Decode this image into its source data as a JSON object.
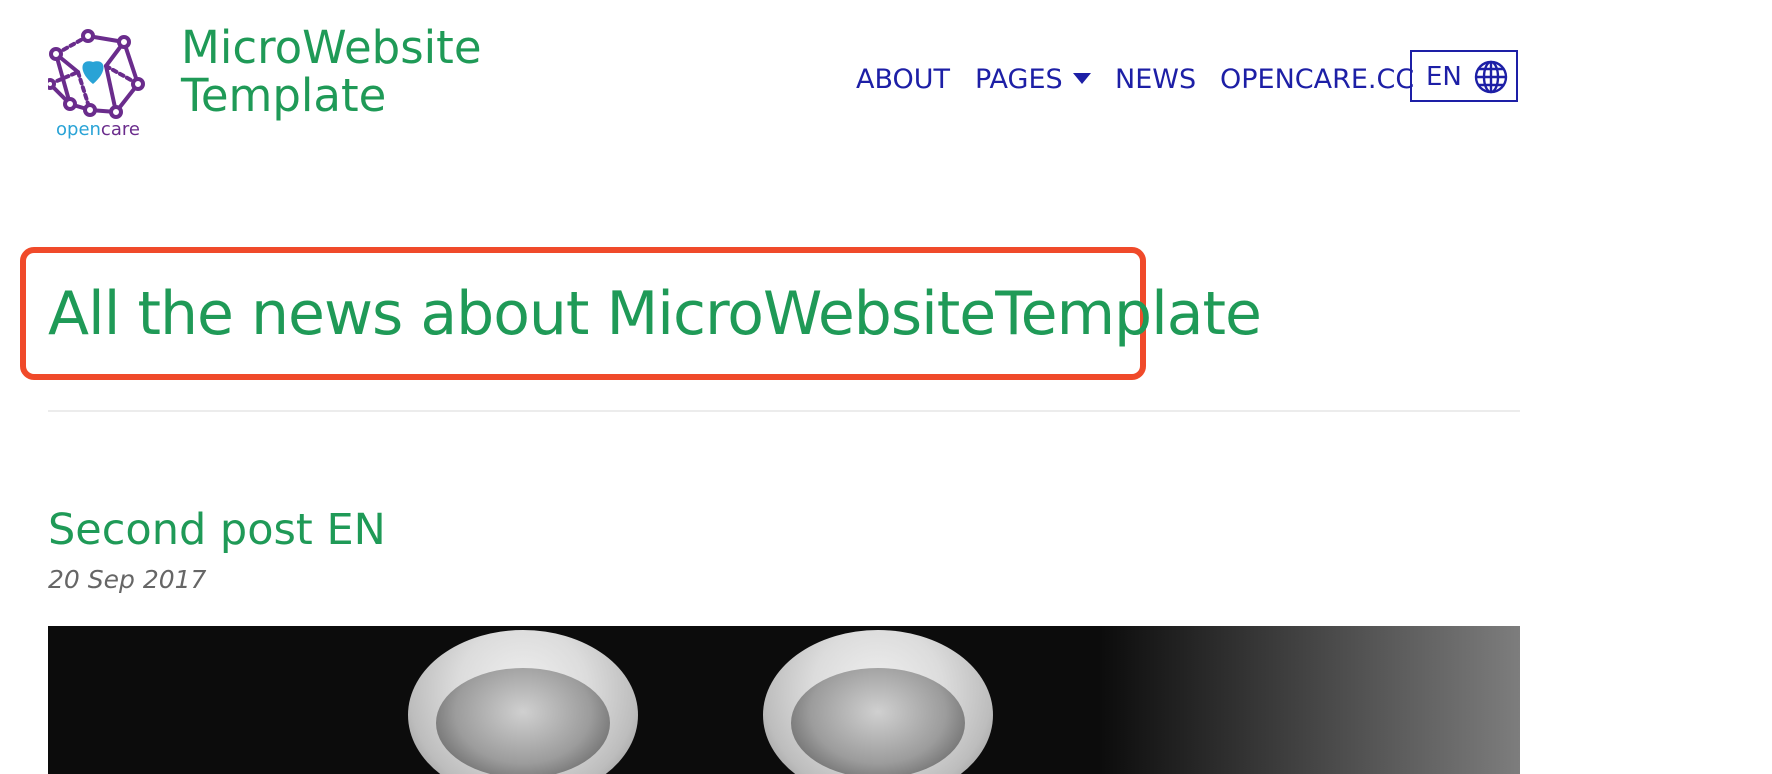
{
  "header": {
    "logo": {
      "word_open": "open",
      "word_care": "care",
      "colors": {
        "purple": "#6a2c8c",
        "blue": "#29a3d6"
      }
    },
    "site_title": "MicroWebsite Template",
    "nav": {
      "items": [
        {
          "label": "ABOUT"
        },
        {
          "label": "PAGES",
          "has_dropdown": true
        },
        {
          "label": "NEWS"
        },
        {
          "label": "OPENCARE.CC"
        }
      ],
      "language": {
        "label": "EN",
        "icon": "globe-icon"
      }
    }
  },
  "main": {
    "page_title": "All the news about MicroWebsiteTemplate",
    "posts": [
      {
        "title": "Second post EN",
        "date": "20 Sep 2017"
      }
    ]
  },
  "colors": {
    "accent_green": "#1f9a57",
    "nav_blue": "#1d1fa6",
    "highlight_red": "#f04a2a"
  }
}
